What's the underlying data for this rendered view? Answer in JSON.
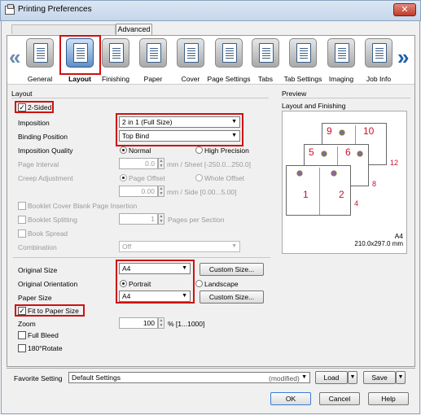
{
  "window": {
    "title": "Printing Preferences",
    "close_glyph": "✕"
  },
  "tabs": {
    "advanced": "Advanced"
  },
  "ribbon": {
    "prev_arrow": "«",
    "next_arrow": "»",
    "items": [
      {
        "label": "General"
      },
      {
        "label": "Layout"
      },
      {
        "label": "Finishing"
      },
      {
        "label": "Paper"
      },
      {
        "label": "Cover"
      },
      {
        "label": "Page Settings"
      },
      {
        "label": "Tabs"
      },
      {
        "label": "Tab Settings"
      },
      {
        "label": "Imaging"
      },
      {
        "label": "Job Info"
      }
    ]
  },
  "layout": {
    "group_label": "Layout",
    "two_sided": {
      "label": "2-Sided",
      "checked": true,
      "mark": "✓"
    },
    "imposition": {
      "label": "Imposition",
      "value": "2 in 1 (Full Size)"
    },
    "binding_position": {
      "label": "Binding Position",
      "value": "Top Bind"
    },
    "imposition_quality": {
      "label": "Imposition Quality",
      "opt_normal": "Normal",
      "opt_high": "High Precision",
      "selected": "Normal"
    },
    "page_interval": {
      "label": "Page Interval",
      "value": "0.0",
      "unit": "mm / Sheet [-250.0...250.0]"
    },
    "creep_adjustment": {
      "label": "Creep Adjustment",
      "opt_page_offset": "Page Offset",
      "opt_whole_offset": "Whole Offset",
      "value": "0.00",
      "unit": "mm / Side [0.00...5.00]"
    },
    "booklet_cover_blank": {
      "label": "Booklet Cover Blank Page Insertion"
    },
    "booklet_splitting": {
      "label": "Booklet Splitting",
      "value": "1",
      "unit": "Pages per Section"
    },
    "book_spread": {
      "label": "Book Spread"
    },
    "combination": {
      "label": "Combination",
      "value": "Off"
    },
    "original_size": {
      "label": "Original Size",
      "value": "A4",
      "button": "Custom Size..."
    },
    "original_orientation": {
      "label": "Original Orientation",
      "opt_portrait": "Portrait",
      "opt_landscape": "Landscape",
      "selected": "Portrait"
    },
    "paper_size": {
      "label": "Paper Size",
      "value": "A4",
      "button": "Custom Size..."
    },
    "fit_to_paper": {
      "label": "Fit to Paper Size",
      "checked": true,
      "mark": "✓"
    },
    "zoom": {
      "label": "Zoom",
      "value": "100",
      "unit": "% [1...1000]"
    },
    "full_bleed": {
      "label": "Full Bleed"
    },
    "rotate_180": {
      "label": "180°Rotate"
    }
  },
  "preview": {
    "group_label": "Preview",
    "caption": "Layout and Finishing",
    "paper_name": "A4",
    "paper_dims": "210.0x297.0 mm",
    "page_numbers": [
      "9",
      "10",
      "5",
      "6",
      "1",
      "2",
      "4",
      "8",
      "12"
    ]
  },
  "footer": {
    "favorite_label": "Favorite Setting",
    "favorite_value": "Default Settings",
    "modified": "(modified)",
    "load": "Load",
    "save": "Save",
    "ok": "OK",
    "cancel": "Cancel",
    "help": "Help"
  },
  "colors": {
    "highlight": "#d01010",
    "page_number": "#c8102e",
    "accent": "#1d5ea8"
  }
}
